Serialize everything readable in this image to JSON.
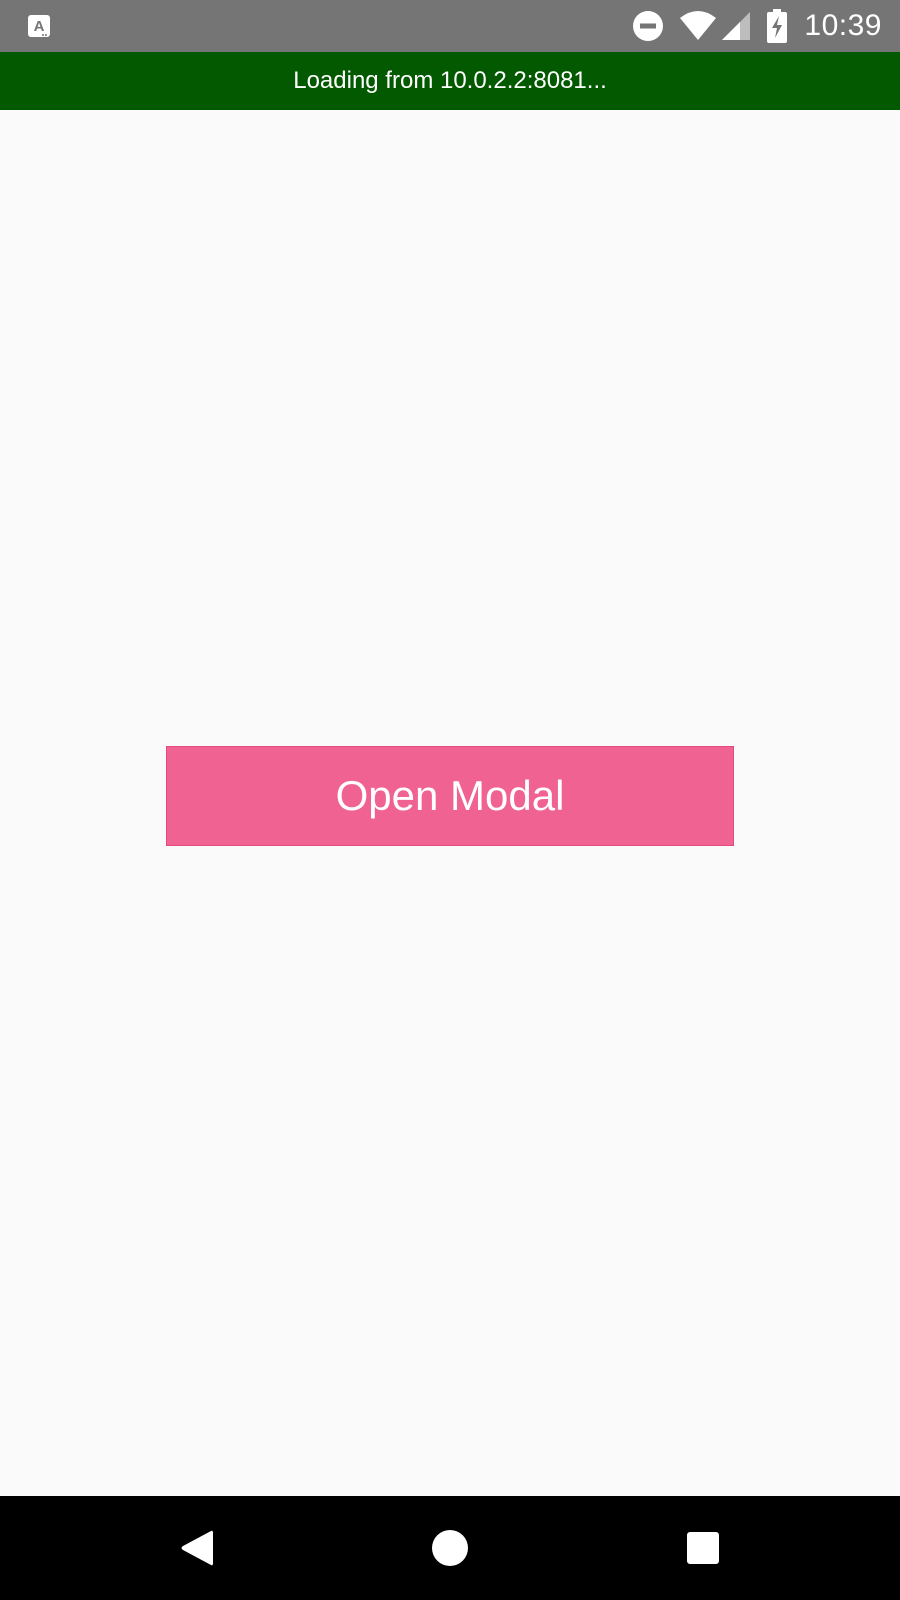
{
  "status_bar": {
    "time": "10:39",
    "icons": {
      "app_notification": "accessibility-a-icon",
      "do_not_disturb": "do-not-disturb-icon",
      "wifi": "wifi-icon",
      "cellular": "cellular-signal-icon",
      "battery": "battery-charging-icon"
    }
  },
  "loading_banner": {
    "text": "Loading from 10.0.2.2:8081..."
  },
  "main": {
    "open_modal_label": "Open Modal"
  },
  "nav_bar": {
    "icons": {
      "back": "back-triangle-icon",
      "home": "home-circle-icon",
      "recents": "recents-square-icon"
    }
  },
  "colors": {
    "status_bar_bg": "#757575",
    "loading_banner_bg": "#035900",
    "content_bg": "#fafafa",
    "button_bg": "#f06292",
    "nav_bar_bg": "#000000"
  }
}
